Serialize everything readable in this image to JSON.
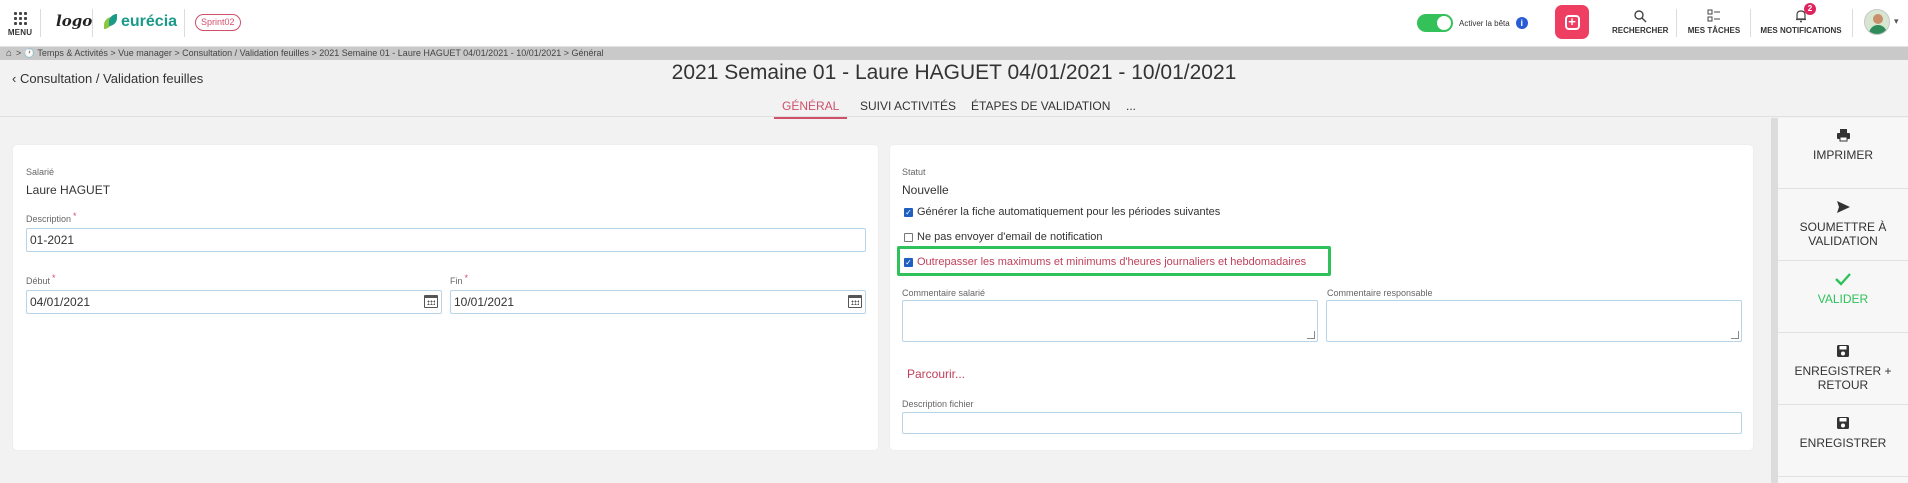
{
  "topbar": {
    "menu_label": "MENU",
    "logo_text": "logo",
    "brand_name": "eurécia",
    "sprint_badge": "Sprint02",
    "beta_label": "Activer la bêta",
    "beta_enabled": true,
    "info_glyph": "i",
    "actions": [
      {
        "label": "RECHERCHER",
        "icon": "search-icon"
      },
      {
        "label": "MES TÂCHES",
        "icon": "tasks-icon"
      },
      {
        "label": "MES NOTIFICATIONS",
        "icon": "bell-icon",
        "badge": "2"
      }
    ],
    "colors": {
      "accent": "#ee3f62",
      "toggle": "#35c15a",
      "brand": "#1a9b8a"
    }
  },
  "breadcrumb": {
    "text": "> 🕐 Temps & Activités > Vue manager > Consultation / Validation feuilles > 2021 Semaine 01 - Laure HAGUET 04/01/2021 - 10/01/2021 > Général"
  },
  "header": {
    "back_label": "Consultation / Validation feuilles",
    "title": "2021 Semaine 01 - Laure HAGUET 04/01/2021 - 10/01/2021",
    "tabs": [
      {
        "label": "GÉNÉRAL",
        "active": true
      },
      {
        "label": "SUIVI ACTIVITÉS",
        "active": false
      },
      {
        "label": "ÉTAPES DE VALIDATION",
        "active": false
      },
      {
        "label": "...",
        "active": false
      }
    ]
  },
  "left_card": {
    "employee_label": "Salarié",
    "employee_value": "Laure HAGUET",
    "description_label": "Description",
    "description_value": "01-2021",
    "start_label": "Début",
    "start_value": "04/01/2021",
    "end_label": "Fin",
    "end_value": "10/01/2021",
    "required_mark": "*"
  },
  "right_card": {
    "status_label": "Statut",
    "status_value": "Nouvelle",
    "checks": [
      {
        "label": "Générer la fiche automatiquement pour les périodes suivantes",
        "checked": true
      },
      {
        "label": "Ne pas envoyer d'email de notification",
        "checked": false
      },
      {
        "label": "Outrepasser les maximums et minimums d'heures journaliers et hebdomadaires",
        "checked": true
      }
    ],
    "employee_comment_label": "Commentaire salarié",
    "manager_comment_label": "Commentaire responsable",
    "browse_label": "Parcourir...",
    "file_description_label": "Description fichier"
  },
  "side_actions": [
    {
      "label": "IMPRIMER",
      "icon": "printer-icon"
    },
    {
      "label": "SOUMETTRE À VALIDATION",
      "icon": "send-icon"
    },
    {
      "label": "VALIDER",
      "icon": "check-icon"
    },
    {
      "label": "ENREGISTRER + RETOUR",
      "icon": "save-return-icon"
    },
    {
      "label": "ENREGISTRER",
      "icon": "save-icon"
    }
  ]
}
